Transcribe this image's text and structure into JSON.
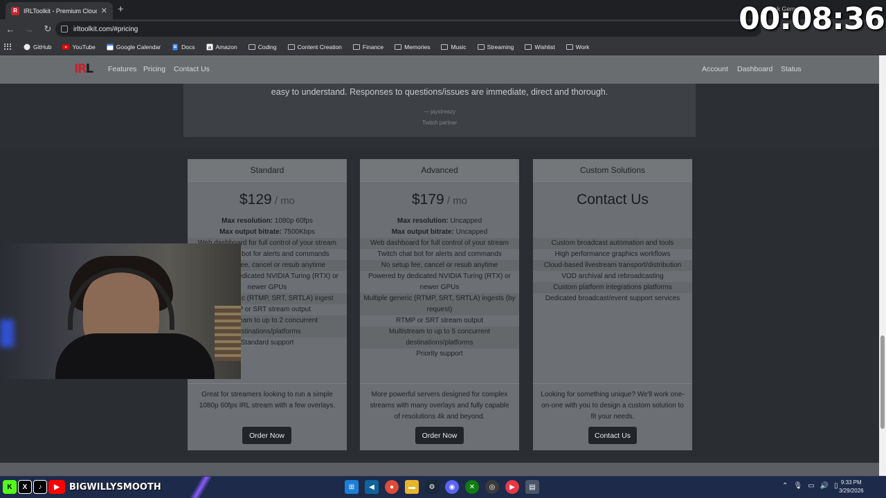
{
  "browser": {
    "tab_title": "IRLToolkit - Premium Cloud Str...",
    "tab_favicon_letter": "R",
    "url": "irltoolkit.com/#pricing",
    "bookmarks": [
      {
        "label": "GitHub",
        "icon": "github-icon"
      },
      {
        "label": "YouTube",
        "icon": "youtube-icon"
      },
      {
        "label": "Google Calendar",
        "icon": "calendar-icon"
      },
      {
        "label": "Docs",
        "icon": "docs-icon"
      },
      {
        "label": "Amazon",
        "icon": "amazon-icon"
      },
      {
        "label": "Coding",
        "icon": "folder-icon"
      },
      {
        "label": "Content Creation",
        "icon": "folder-icon"
      },
      {
        "label": "Finance",
        "icon": "folder-icon"
      },
      {
        "label": "Memories",
        "icon": "folder-icon"
      },
      {
        "label": "Music",
        "icon": "folder-icon"
      },
      {
        "label": "Streaming",
        "icon": "folder-icon"
      },
      {
        "label": "Wishlist",
        "icon": "folder-icon"
      },
      {
        "label": "Work",
        "icon": "folder-icon"
      }
    ],
    "partial_text": "sk Gem"
  },
  "overlay": {
    "timer": "00:08:36",
    "handle": "BIGWILLYSMOOTH"
  },
  "site": {
    "logo_red": "IR",
    "logo_dark": "L",
    "nav_left": [
      "Features",
      "Pricing",
      "Contact Us"
    ],
    "nav_right": [
      "Account",
      "Dashboard",
      "Status"
    ],
    "testimonial": {
      "quote": "easy to understand. Responses to questions/issues are immediate, direct and thorough.",
      "author": "— jaystreazy",
      "role": "Twitch partner"
    },
    "plans": [
      {
        "name": "Standard",
        "price": "$129",
        "per": " / mo",
        "max_res_label": "Max resolution:",
        "max_res_value": " 1080p 60fps",
        "max_bitrate_label": "Max output bitrate:",
        "max_bitrate_value": " 7500Kbps",
        "features": [
          "Web dashboard for full control of your stream",
          "Twitch chat bot for alerts and commands",
          "No setup fee, cancel or resub anytime",
          "Powered by dedicated NVIDIA Turing (RTX) or newer GPUs",
          "Single generic (RTMP, SRT, SRTLA) ingest",
          "RTMP or SRT stream output",
          "Multistream to up to 2 concurrent destinations/platforms",
          "Standard support"
        ],
        "description": "Great for streamers looking to run a simple 1080p 60fps IRL stream with a few overlays.",
        "button": "Order Now"
      },
      {
        "name": "Advanced",
        "price": "$179",
        "per": " / mo",
        "max_res_label": "Max resolution:",
        "max_res_value": " Uncapped",
        "max_bitrate_label": "Max output bitrate:",
        "max_bitrate_value": " Uncapped",
        "features": [
          "Web dashboard for full control of your stream",
          "Twitch chat bot for alerts and commands",
          "No setup fee, cancel or resub anytime",
          "Powered by dedicated NVIDIA Turing (RTX) or newer GPUs",
          "Multiple generic (RTMP, SRT, SRTLA) ingests (by request)",
          "RTMP or SRT stream output",
          "Multistream to up to 5 concurrent destinations/platforms",
          "Priority support"
        ],
        "description": "More powerful servers designed for complex streams with many overlays and fully capable of resolutions 4k and beyond.",
        "button": "Order Now"
      },
      {
        "name": "Custom Solutions",
        "price": "Contact Us",
        "features": [
          "Custom broadcast automation and tools",
          "High performance graphics workflows",
          "Cloud-based livestream transport/distribution",
          "VOD archival and rebroadcasting",
          "Custom platform integrations platforms",
          "Dedicated broadcast/event support services"
        ],
        "description": "Looking for something unique? We'll work one-on-one with you to design a custom solution to fit your needs.",
        "button": "Contact Us"
      }
    ]
  },
  "taskbar": {
    "time": "9:33 PM",
    "date": "3/29/2026"
  }
}
